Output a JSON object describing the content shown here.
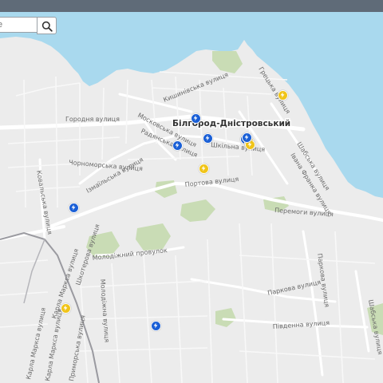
{
  "search": {
    "placeholder": "e"
  },
  "city_label": "Білгород-Дністровський",
  "streets": {
    "horodnia": "Городня вулиця",
    "kyshynivska": "Кишинівська вулиця",
    "moskovska": "Московська вулиця",
    "radianska": "Радянська вулиця",
    "chornomorska": "Чорноморська вулиця",
    "izmailska": "Ізмаїльська вулиця",
    "kovalska": "Ковальська вулиця",
    "shkilna": "Шкільна вулиця",
    "portova": "Портова вулиця",
    "molodizhnyi": "Молодіжний провулок",
    "peremohy": "Перемоги вулиця",
    "shabska": "Шабська вулиця",
    "ivana_franka": "Івана Франка вулиця",
    "hretska": "Грецька вулиця",
    "parkova": "Паркова вулиця",
    "pivdenna": "Південна вулиця",
    "shabska_lower": "Шабська вулиця",
    "molodizhna": "Молодіжна вулиця",
    "parkova_vertical": "Паркова вулиця",
    "karla_marksa": "Карла Маркса вулиця",
    "prymorska": "Приморська вулиця",
    "shkoterova": "Шкотерова вулиця",
    "kovalska_lower": "Карла Маркса вулиця",
    "karla_marksa_2": "Карла Маркса вулиця"
  },
  "markers": [
    {
      "type": "blue",
      "name": "charging-station-blue-1"
    },
    {
      "type": "blue",
      "name": "charging-station-blue-2"
    },
    {
      "type": "blue",
      "name": "charging-station-blue-3"
    },
    {
      "type": "blue",
      "name": "charging-station-blue-4"
    },
    {
      "type": "blue",
      "name": "charging-station-blue-5"
    },
    {
      "type": "blue",
      "name": "charging-station-blue-6"
    },
    {
      "type": "yellow",
      "name": "charging-station-yellow-1"
    },
    {
      "type": "yellow",
      "name": "charging-station-yellow-2"
    },
    {
      "type": "yellow",
      "name": "charging-station-yellow-3"
    },
    {
      "type": "yellow",
      "name": "charging-station-yellow-4"
    },
    {
      "type": "yellow",
      "name": "charging-station-yellow-5"
    },
    {
      "type": "blue",
      "name": "charging-station-blue-7"
    }
  ],
  "colors": {
    "water": "#a9d9ee",
    "land": "#ececec",
    "park": "#c9dcb5",
    "road": "#ffffff",
    "marker_blue": "#1a5fd6",
    "marker_yellow": "#f0c419",
    "topbar": "#5f6b78"
  },
  "icons": {
    "search": "magnifier-icon",
    "marker": "lightning-bolt-icon"
  }
}
